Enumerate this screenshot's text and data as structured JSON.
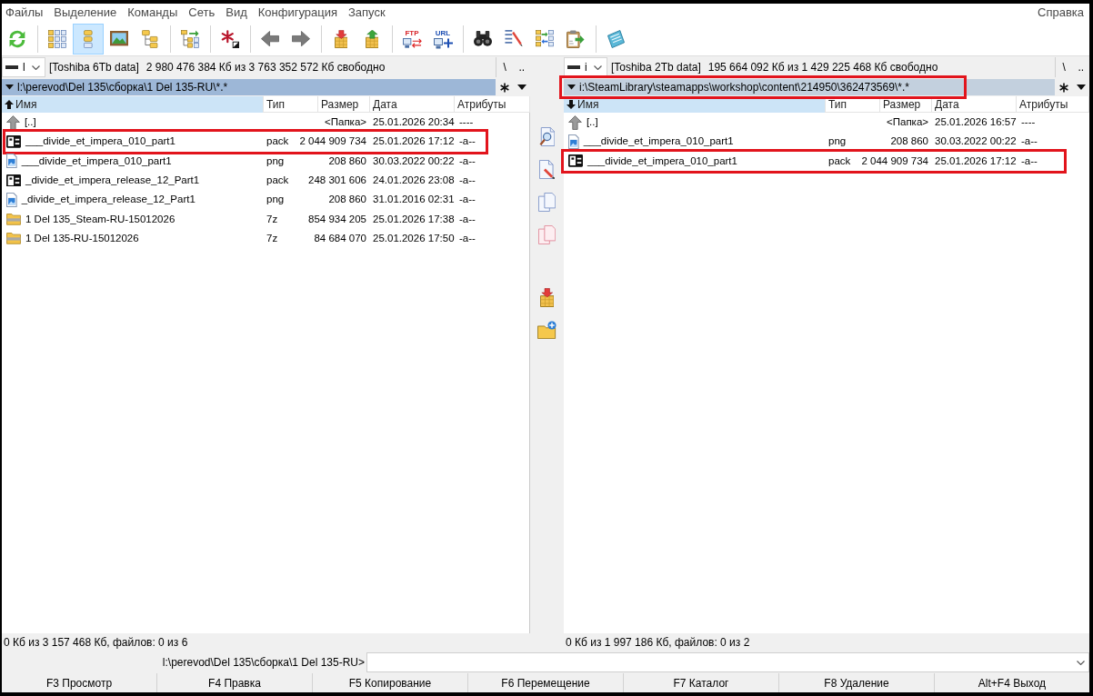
{
  "menu": [
    "Файлы",
    "Выделение",
    "Команды",
    "Сеть",
    "Вид",
    "Конфигурация",
    "Запуск"
  ],
  "help_menu": "Справка",
  "toolbar": [
    {
      "buttons": [
        {
          "kind": "refresh",
          "selected": false
        }
      ]
    },
    {
      "buttons": [
        {
          "kind": "grid",
          "selected": false
        },
        {
          "kind": "list",
          "selected": true
        },
        {
          "kind": "picture",
          "selected": false
        },
        {
          "kind": "tree",
          "selected": false
        }
      ]
    },
    {
      "buttons": [
        {
          "kind": "compare",
          "selected": false
        }
      ]
    },
    {
      "buttons": [
        {
          "kind": "asterisk",
          "selected": false
        }
      ]
    },
    {
      "buttons": [
        {
          "kind": "back",
          "selected": false
        },
        {
          "kind": "forward",
          "selected": false
        }
      ]
    },
    {
      "buttons": [
        {
          "kind": "pack",
          "selected": false
        },
        {
          "kind": "unpack",
          "selected": false
        }
      ]
    },
    {
      "buttons": [
        {
          "kind": "ftp",
          "label": "FTP",
          "selected": false
        },
        {
          "kind": "url",
          "label": "URL",
          "selected": false
        }
      ]
    },
    {
      "buttons": [
        {
          "kind": "search",
          "selected": false
        },
        {
          "kind": "rename",
          "selected": false
        },
        {
          "kind": "sync",
          "selected": false
        },
        {
          "kind": "clipboard",
          "selected": false
        }
      ]
    },
    {
      "buttons": [
        {
          "kind": "notepad",
          "selected": false
        }
      ]
    }
  ],
  "left_panel": {
    "active": true,
    "drive": "l",
    "drive_label": "[Toshiba 6Tb data]",
    "drive_space": "2 980 476 384 Кб из 3 763 352 572 Кб свободно",
    "root_button": "\\",
    "up_button": "..",
    "path": "l:\\perevod\\Del 135\\сборка\\1 Del 135-RU\\*.*",
    "path_highlighted": false,
    "columns": [
      {
        "label": "Имя",
        "sorted": true,
        "descending": false
      },
      {
        "label": "Тип",
        "sorted": false
      },
      {
        "label": "Размер",
        "sorted": false
      },
      {
        "label": "Дата",
        "sorted": false
      },
      {
        "label": "Атрибуты",
        "sorted": false
      }
    ],
    "files": [
      {
        "kind": "parent",
        "name": "[..]",
        "size": "<Папка>",
        "date": "25.01.2026 20:34",
        "attributes": "----",
        "highlighted": false
      },
      {
        "kind": "archive",
        "name": "___divide_et_impera_010_part1",
        "type": "pack",
        "size": "2 044 909 734",
        "date": "25.01.2026 17:12",
        "attributes": "-a--",
        "highlighted": true
      },
      {
        "kind": "image",
        "name": "___divide_et_impera_010_part1",
        "type": "png",
        "size": "208 860",
        "date": "30.03.2022 00:22",
        "attributes": "-a--",
        "highlighted": false
      },
      {
        "kind": "archive",
        "name": "_divide_et_impera_release_12_Part1",
        "type": "pack",
        "size": "248 301 606",
        "date": "24.01.2026 23:08",
        "attributes": "-a--",
        "highlighted": false
      },
      {
        "kind": "image",
        "name": "_divide_et_impera_release_12_Part1",
        "type": "png",
        "size": "208 860",
        "date": "31.01.2016 02:31",
        "attributes": "-a--",
        "highlighted": false
      },
      {
        "kind": "zipped",
        "name": "1 Del 135_Steam-RU-15012026",
        "type": "7z",
        "size": "854 934 205",
        "date": "25.01.2026 17:38",
        "attributes": "-a--",
        "highlighted": false
      },
      {
        "kind": "zipped",
        "name": "1 Del 135-RU-15012026",
        "type": "7z",
        "size": "84 684 070",
        "date": "25.01.2026 17:50",
        "attributes": "-a--",
        "highlighted": false
      }
    ],
    "status": "0 Кб из 3 157 468 Кб, файлов: 0 из 6"
  },
  "middle_toolbar": [
    {
      "buttons": [
        {
          "kind": "view"
        },
        {
          "kind": "edit"
        },
        {
          "kind": "copy"
        },
        {
          "kind": "move"
        }
      ]
    },
    {
      "buttons": [
        {
          "kind": "pack"
        },
        {
          "kind": "newfolder"
        }
      ]
    }
  ],
  "right_panel": {
    "active": false,
    "drive": "i",
    "drive_label": "[Toshiba 2Tb data]",
    "drive_space": "195 664 092 Кб из 1 429 225 468 Кб свободно",
    "root_button": "\\",
    "up_button": "..",
    "path": "i:\\SteamLibrary\\steamapps\\workshop\\content\\214950\\362473569\\*.*",
    "path_highlighted": true,
    "columns": [
      {
        "label": "Имя",
        "sorted": true,
        "descending": true
      },
      {
        "label": "Тип",
        "sorted": false
      },
      {
        "label": "Размер",
        "sorted": false
      },
      {
        "label": "Дата",
        "sorted": false
      },
      {
        "label": "Атрибуты",
        "sorted": false
      }
    ],
    "files": [
      {
        "kind": "parent",
        "name": "[..]",
        "size": "<Папка>",
        "date": "25.01.2026 16:57",
        "attributes": "----",
        "highlighted": false
      },
      {
        "kind": "image",
        "name": "___divide_et_impera_010_part1",
        "type": "png",
        "size": "208 860",
        "date": "30.03.2022 00:22",
        "attributes": "-a--",
        "highlighted": false
      },
      {
        "kind": "archive",
        "name": "___divide_et_impera_010_part1",
        "type": "pack",
        "size": "2 044 909 734",
        "date": "25.01.2026 17:12",
        "attributes": "-a--",
        "highlighted": true
      }
    ],
    "status": "0 Кб из 1 997 186 Кб, файлов: 0 из 2"
  },
  "command_line": {
    "prompt": "l:\\perevod\\Del 135\\сборка\\1 Del 135-RU>"
  },
  "function_keys": [
    "F3 Просмотр",
    "F4 Правка",
    "F5 Копирование",
    "F6 Перемещение",
    "F7 Каталог",
    "F8 Удаление",
    "Alt+F4 Выход"
  ]
}
